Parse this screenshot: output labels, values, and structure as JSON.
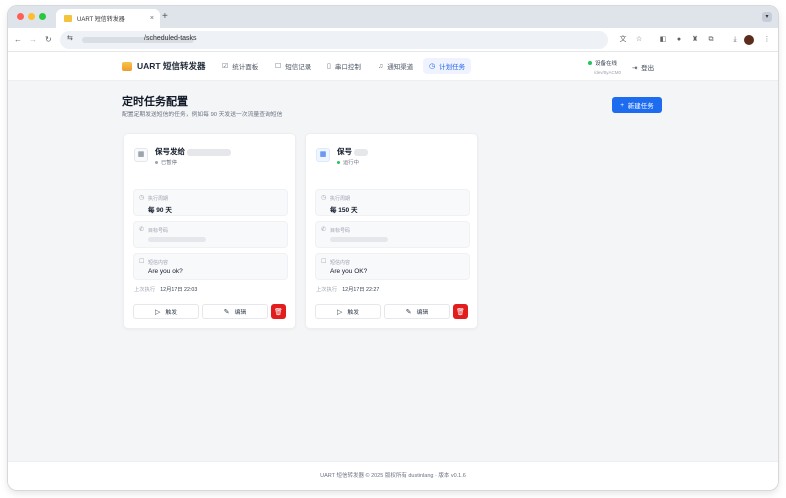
{
  "browser": {
    "tab_title": "UART 短信转发器",
    "new_tab": "+",
    "tab_close": "×",
    "url_path": "/scheduled-tasks",
    "icons": [
      "back-icon",
      "forward-icon",
      "reload-icon",
      "translate-icon",
      "star-icon",
      "extensions-icon",
      "download-icon",
      "more-icon"
    ]
  },
  "header": {
    "brand": "UART 短信转发器",
    "nav": [
      {
        "label": "统计面板",
        "icon": "chart-icon"
      },
      {
        "label": "短信记录",
        "icon": "message-icon"
      },
      {
        "label": "串口控制",
        "icon": "device-icon"
      },
      {
        "label": "通知渠道",
        "icon": "bell-icon"
      },
      {
        "label": "计划任务",
        "icon": "clock-icon",
        "active": true
      }
    ],
    "device_status": "设备在线",
    "device_port": "/dev/ttyACM0",
    "logout": "登出"
  },
  "main": {
    "title": "定时任务配置",
    "subtitle": "配置定期发送短信的任务，例如每 90 天发送一次流量查询短信",
    "new_task": "新建任务"
  },
  "tasks": [
    {
      "title": "保号发给",
      "status": "已暂停",
      "period_label": "执行周期",
      "period_value": "每 90 天",
      "phone_label": "目标号码",
      "content_label": "短信内容",
      "content_value": "Are you ok?",
      "last_label": "上次执行",
      "last_value": "12月17日 22:03",
      "trigger": "触发",
      "edit": "编辑"
    },
    {
      "title": "保号",
      "status": "运行中",
      "period_label": "执行周期",
      "period_value": "每 150 天",
      "phone_label": "目标号码",
      "content_label": "短信内容",
      "content_value": "Are you OK?",
      "last_label": "上次执行",
      "last_value": "12月17日 22:27",
      "trigger": "触发",
      "edit": "编辑"
    }
  ],
  "footer": "UART 短信转发器 © 2025 版权所有 dustinlang · 版本 v0.1.6",
  "colors": {
    "accent": "#1d6cf0",
    "danger": "#e11d1d",
    "online": "#22c55e"
  }
}
